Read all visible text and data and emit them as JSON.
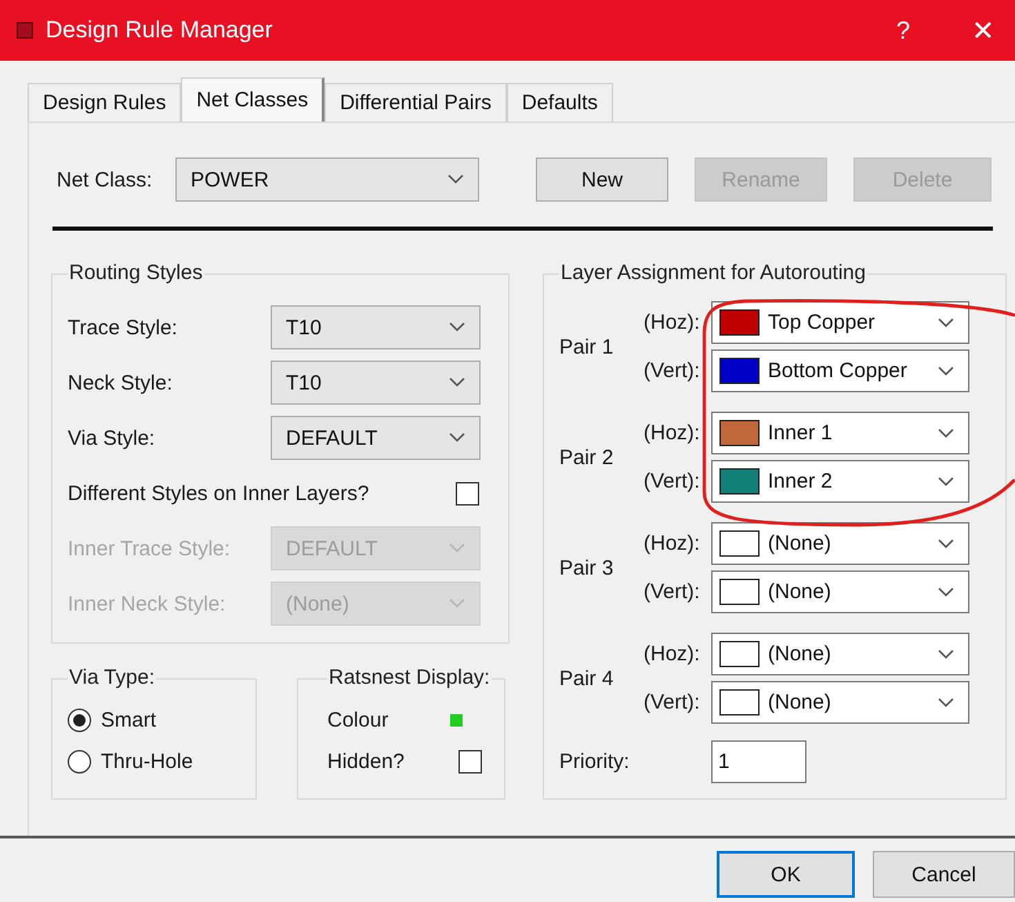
{
  "window": {
    "title": "Design Rule Manager",
    "help_button": "?",
    "close_button": "✕"
  },
  "tabs": [
    {
      "label": "Design Rules",
      "selected": false
    },
    {
      "label": "Net Classes",
      "selected": true
    },
    {
      "label": "Differential Pairs",
      "selected": false
    },
    {
      "label": "Defaults",
      "selected": false
    }
  ],
  "net_class": {
    "label": "Net Class:",
    "value": "POWER"
  },
  "class_buttons": [
    {
      "label": "New",
      "disabled": false
    },
    {
      "label": "Rename",
      "disabled": true
    },
    {
      "label": "Delete",
      "disabled": true
    }
  ],
  "routing_styles": {
    "title": "Routing Styles",
    "rows": [
      {
        "kind": "combo",
        "label": "Trace Style:",
        "value": "T10",
        "disabled": false
      },
      {
        "kind": "combo",
        "label": "Neck Style:",
        "value": "T10",
        "disabled": false
      },
      {
        "kind": "combo",
        "label": "Via Style:",
        "value": "DEFAULT",
        "disabled": false
      },
      {
        "kind": "checkbox",
        "label": "Different Styles on Inner Layers?",
        "checked": false
      },
      {
        "kind": "combo",
        "label": "Inner Trace Style:",
        "value": "DEFAULT",
        "disabled": true
      },
      {
        "kind": "combo",
        "label": "Inner Neck Style:",
        "value": "(None)",
        "disabled": true
      }
    ]
  },
  "via_type": {
    "title": "Via Type:",
    "options": [
      {
        "label": "Smart",
        "selected": true
      },
      {
        "label": "Thru-Hole",
        "selected": false
      }
    ]
  },
  "ratsnest": {
    "title": "Ratsnest Display:",
    "colour": {
      "label": "Colour",
      "color": "#22cc22"
    },
    "hidden": {
      "label": "Hidden?",
      "checked": false
    }
  },
  "layer_assignment": {
    "title": "Layer Assignment for Autorouting",
    "pairs": [
      {
        "name": "Pair 1",
        "layers": [
          {
            "label": "(Hoz):",
            "value": "Top Copper",
            "color": "#c00000"
          },
          {
            "label": "(Vert):",
            "value": "Bottom Copper",
            "color": "#0000c8"
          }
        ]
      },
      {
        "name": "Pair 2",
        "layers": [
          {
            "label": "(Hoz):",
            "value": "Inner 1",
            "color": "#c0683a"
          },
          {
            "label": "(Vert):",
            "value": "Inner 2",
            "color": "#138078"
          }
        ]
      },
      {
        "name": "Pair 3",
        "layers": [
          {
            "label": "(Hoz):",
            "value": "(None)",
            "color": "#ffffff"
          },
          {
            "label": "(Vert):",
            "value": "(None)",
            "color": "#ffffff"
          }
        ]
      },
      {
        "name": "Pair 4",
        "layers": [
          {
            "label": "(Hoz):",
            "value": "(None)",
            "color": "#ffffff"
          },
          {
            "label": "(Vert):",
            "value": "(None)",
            "color": "#ffffff"
          }
        ]
      }
    ],
    "priority": {
      "label": "Priority:",
      "value": "1"
    }
  },
  "buttons": [
    {
      "label": "OK",
      "default": true
    },
    {
      "label": "Cancel",
      "default": false
    }
  ],
  "annotation": {
    "kind": "circle"
  }
}
